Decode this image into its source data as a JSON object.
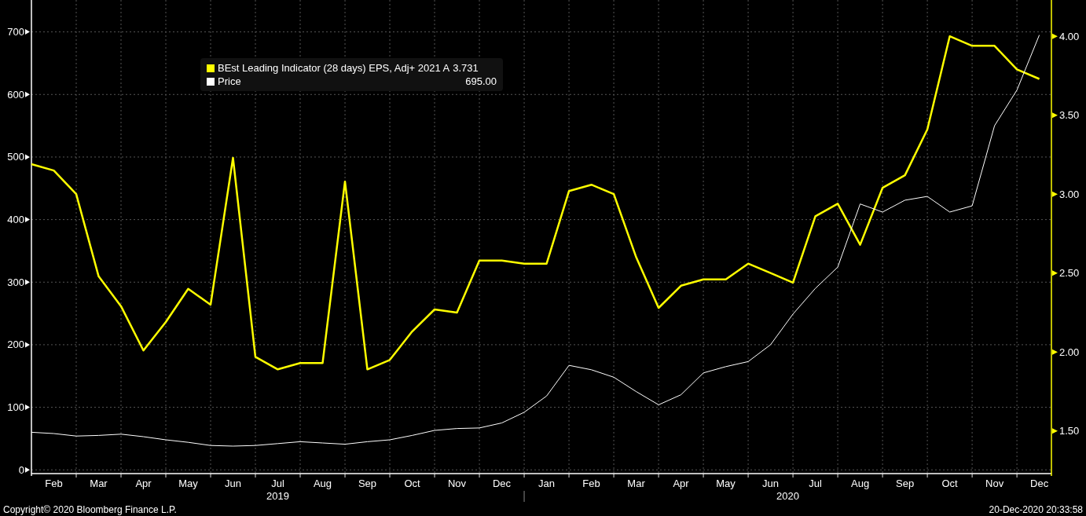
{
  "chart_data": {
    "type": "line",
    "categories": [
      null,
      "Feb",
      null,
      "Mar",
      null,
      "Apr",
      null,
      "May",
      null,
      "Jun",
      null,
      "Jul",
      null,
      "Aug",
      null,
      "Sep",
      null,
      "Oct",
      null,
      "Nov",
      null,
      "Dec",
      null,
      "Jan",
      null,
      "Feb",
      null,
      "Mar",
      null,
      "Apr",
      null,
      "May",
      null,
      "Jun",
      null,
      "Jul",
      null,
      "Aug",
      null,
      "Sep",
      null,
      "Oct",
      null,
      "Nov",
      null,
      "Dec"
    ],
    "series": [
      {
        "name": "BEst Leading Indicator (28 days) EPS, Adj+ 2021 A",
        "color": "#ffff00",
        "axis": "y2",
        "values": [
          3.19,
          3.15,
          3.0,
          2.48,
          2.29,
          2.01,
          2.19,
          2.4,
          2.3,
          3.23,
          1.97,
          1.89,
          1.93,
          1.93,
          3.08,
          1.89,
          1.95,
          2.13,
          2.27,
          2.25,
          2.58,
          2.58,
          2.56,
          2.56,
          3.02,
          3.06,
          3.0,
          2.6,
          2.28,
          2.42,
          2.46,
          2.46,
          2.56,
          2.5,
          2.44,
          2.86,
          2.94,
          2.68,
          3.04,
          3.12,
          3.41,
          4.0,
          3.94,
          3.94,
          3.79,
          3.73
        ]
      },
      {
        "name": "Price",
        "color": "#ffffff",
        "values": [
          60,
          58,
          54,
          55,
          57,
          53,
          48,
          44,
          39,
          38,
          39,
          42,
          45,
          43,
          41,
          45,
          48,
          55,
          63,
          66,
          67,
          75,
          92,
          118,
          167,
          160,
          148,
          125,
          104,
          120,
          155,
          165,
          173,
          200,
          249,
          290,
          324,
          425,
          412,
          431,
          437,
          412,
          422,
          550,
          607,
          695
        ]
      }
    ],
    "grid": true,
    "ylim": [
      -6,
      751
    ],
    "yticks": [
      0,
      100,
      200,
      300,
      400,
      500,
      600,
      700
    ],
    "y2lim": [
      1.23,
      4.23
    ],
    "y2ticks": [
      {
        "value": 1.5,
        "label": "1.50"
      },
      {
        "value": 2,
        "label": "2.00"
      },
      {
        "value": 2.5,
        "label": "2.50"
      },
      {
        "value": 3,
        "label": "3.00"
      },
      {
        "value": 3.5,
        "label": "3.50"
      },
      {
        "value": 4,
        "label": "4.00"
      }
    ]
  },
  "year_labels": [
    "2019",
    "2020"
  ],
  "legend": [
    {
      "value": "3.731",
      "kind": "inline"
    },
    {
      "value": "695.00",
      "kind": "right"
    }
  ],
  "footer": {
    "copyright": "Copyright© 2020 Bloomberg Finance L.P.",
    "timestamp": "20-Dec-2020 20:33:58"
  }
}
